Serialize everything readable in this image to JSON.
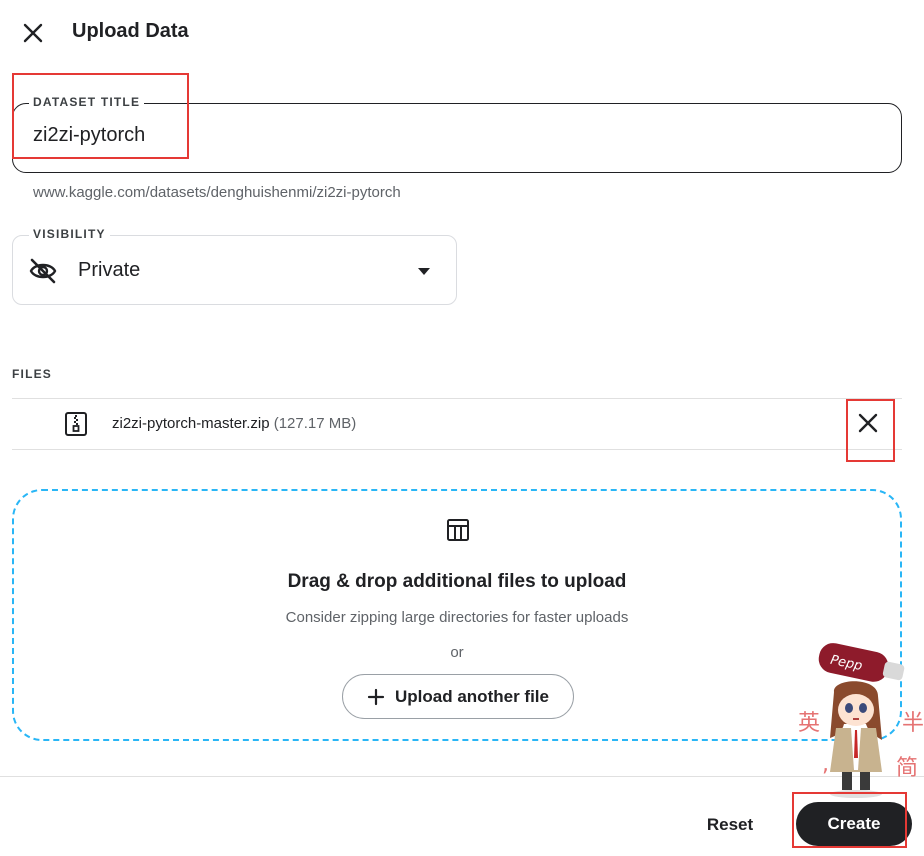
{
  "header": {
    "title": "Upload Data",
    "close_icon": "close-icon"
  },
  "dataset_title": {
    "label": "DATASET TITLE",
    "value": "zi2zi-pytorch"
  },
  "url": "www.kaggle.com/datasets/denghuishenmi/zi2zi-pytorch",
  "visibility": {
    "label": "VISIBILITY",
    "value": "Private",
    "icon": "visibility-off-icon"
  },
  "files": {
    "label": "FILES",
    "items": [
      {
        "name": "zi2zi-pytorch-master.zip",
        "size": "(127.17 MB)",
        "icon": "zip-file-icon"
      }
    ]
  },
  "dropzone": {
    "title": "Drag & drop additional files to upload",
    "subtitle": "Consider zipping large directories for faster uploads",
    "or": "or",
    "upload_label": "Upload another file"
  },
  "footer": {
    "reset_label": "Reset",
    "create_label": "Create"
  },
  "decor": {
    "chars": [
      "英",
      "半",
      "简",
      ",",
      "。"
    ]
  },
  "colors": {
    "accent_dashed": "#29b6f6",
    "primary_button": "#202124",
    "annotation": "#e53935"
  }
}
